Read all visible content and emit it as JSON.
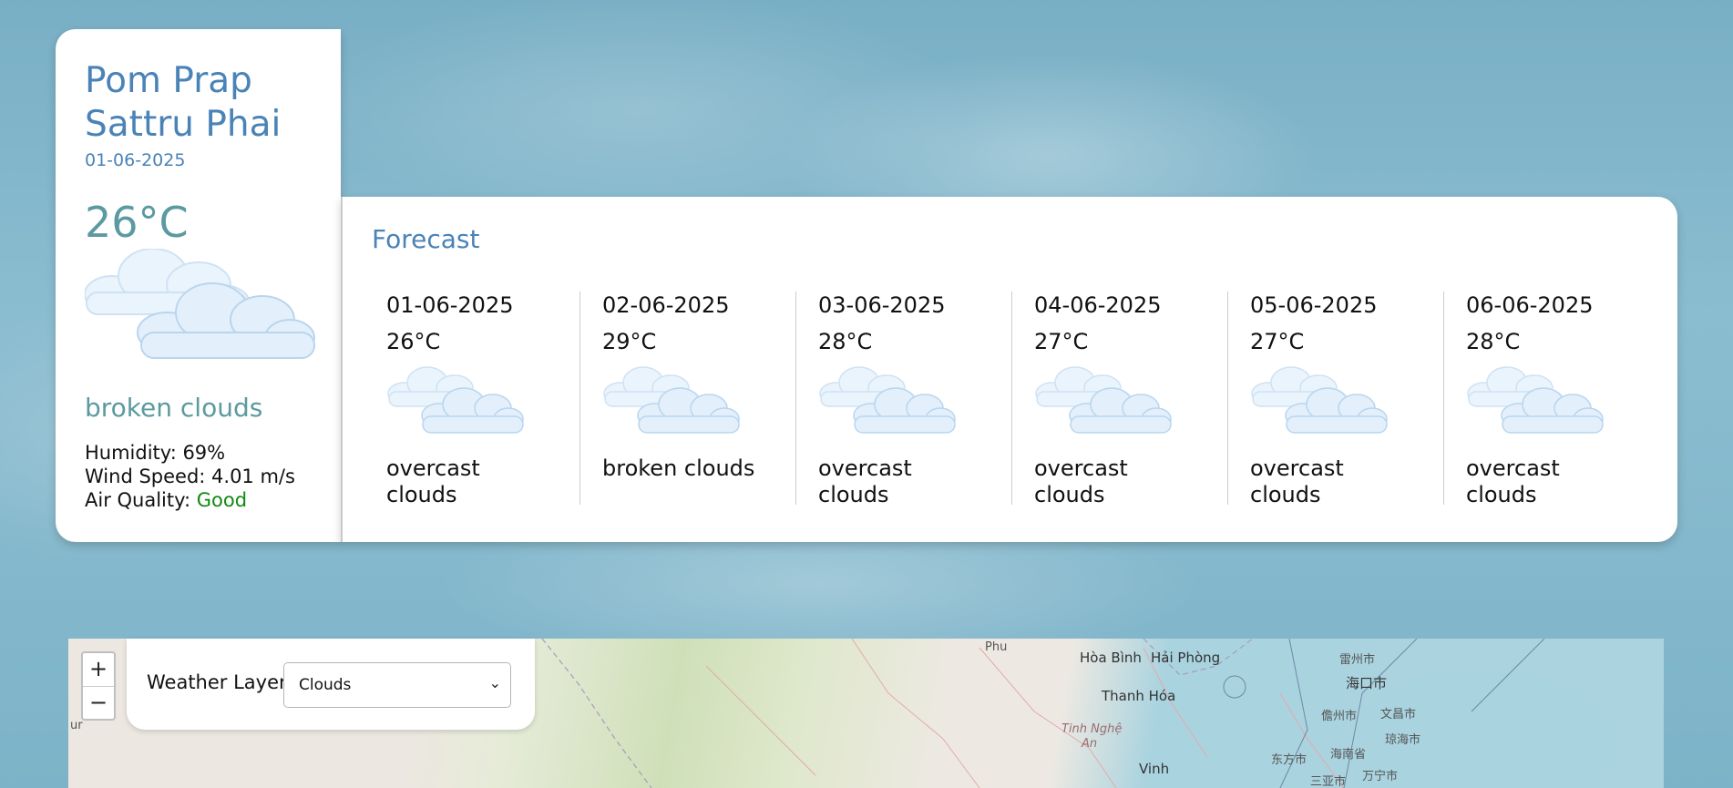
{
  "current": {
    "city_line1": "Pom Prap",
    "city_line2": "Sattru Phai",
    "date": "01-06-2025",
    "temperature": "26°C",
    "icon": "broken-clouds-icon",
    "description": "broken clouds",
    "humidity_label": "Humidity: 69%",
    "wind_label": "Wind Speed: 4.01 m/s",
    "air_quality_label": "Air Quality: ",
    "air_quality_value": "Good",
    "air_quality_color": "#118a11"
  },
  "forecast": {
    "title": "Forecast",
    "days": [
      {
        "date": "01-06-2025",
        "temp": "26°C",
        "icon": "clouds-icon",
        "desc": "overcast clouds"
      },
      {
        "date": "02-06-2025",
        "temp": "29°C",
        "icon": "clouds-icon",
        "desc": "broken clouds"
      },
      {
        "date": "03-06-2025",
        "temp": "28°C",
        "icon": "clouds-icon",
        "desc": "overcast clouds"
      },
      {
        "date": "04-06-2025",
        "temp": "27°C",
        "icon": "clouds-icon",
        "desc": "overcast clouds"
      },
      {
        "date": "05-06-2025",
        "temp": "27°C",
        "icon": "clouds-icon",
        "desc": "overcast clouds"
      },
      {
        "date": "06-06-2025",
        "temp": "28°C",
        "icon": "clouds-icon",
        "desc": "overcast clouds"
      }
    ]
  },
  "map": {
    "zoom_in": "+",
    "zoom_out": "−",
    "layer_label": "Weather Layer:",
    "layer_selected": "Clouds",
    "labels": {
      "phu": "Phu",
      "hoa_binh": "Hòa Bình",
      "hai_phong": "Hải Phòng",
      "thanh_hoa": "Thanh Hóa",
      "tinh_nghe": "Tinh Nghệ",
      "an": "An",
      "vinh": "Vinh",
      "zhanjiang": "雷州市",
      "haikou": "海口市",
      "danzhou": "儋州市",
      "wenchang": "文昌市",
      "qionghai": "琼海市",
      "dongfang": "东方市",
      "hainan": "海南省",
      "wanning": "万宁市",
      "sanya": "三亚市",
      "ur": "ur"
    }
  }
}
